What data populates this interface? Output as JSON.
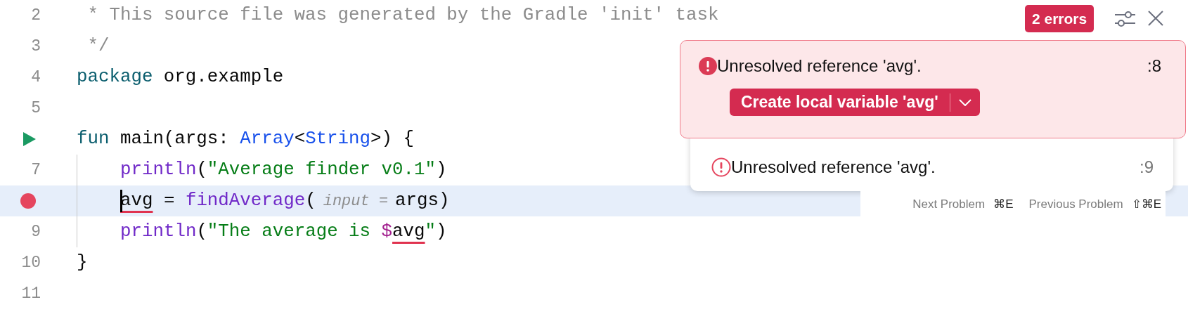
{
  "editor": {
    "lines": [
      {
        "number": "2",
        "tokens": [
          {
            "kind": "comment",
            "text": " * This source file was generated by the Gradle 'init' task"
          }
        ]
      },
      {
        "number": "3",
        "tokens": [
          {
            "kind": "comment",
            "text": " */"
          }
        ]
      },
      {
        "number": "4",
        "tokens": [
          {
            "kind": "keyword",
            "text": "package"
          },
          {
            "kind": "plain",
            "text": " org.example"
          }
        ]
      },
      {
        "number": "5"
      },
      {
        "gutter_icon": {
          "kind": "run"
        },
        "tokens": [
          {
            "kind": "keyword",
            "text": "fun"
          },
          {
            "kind": "plain",
            "text": " main(args: "
          },
          {
            "kind": "type",
            "text": "Array"
          },
          {
            "kind": "plain",
            "text": "<"
          },
          {
            "kind": "type",
            "text": "String"
          },
          {
            "kind": "plain",
            "text": ">) {"
          }
        ],
        "children": [
          {
            "number": "7",
            "tokens": [
              {
                "kind": "call",
                "text": "println"
              },
              {
                "kind": "plain",
                "text": "("
              },
              {
                "kind": "string",
                "text": "\"Average finder v0.1\""
              },
              {
                "kind": "plain",
                "text": ")"
              }
            ]
          },
          {
            "gutter_icon": {
              "kind": "breakpoint"
            },
            "current": true,
            "caret": true,
            "tokens": [
              {
                "kind": "plain",
                "text": "avg",
                "error": true
              },
              {
                "kind": "plain",
                "text": " = "
              },
              {
                "kind": "call",
                "text": "findAverage"
              },
              {
                "kind": "plain",
                "text": "("
              },
              {
                "kind": "hint",
                "text": "input ="
              },
              {
                "kind": "plain",
                "text": "args)"
              }
            ]
          },
          {
            "number": "9",
            "tokens": [
              {
                "kind": "call",
                "text": "println"
              },
              {
                "kind": "plain",
                "text": "("
              },
              {
                "kind": "string",
                "text": "\"The average is "
              },
              {
                "kind": "interp",
                "text": "$"
              },
              {
                "kind": "plain",
                "text": "avg",
                "error": true
              },
              {
                "kind": "string",
                "text": "\""
              },
              {
                "kind": "plain",
                "text": ")"
              }
            ]
          }
        ]
      },
      {
        "number": "10",
        "tokens": [
          {
            "kind": "plain",
            "text": "}"
          }
        ]
      },
      {
        "number": "11"
      }
    ]
  },
  "problems_popup": {
    "badge": "2 errors",
    "problems": [
      {
        "message": "Unresolved reference 'avg'.",
        "line": ":8",
        "selected": true,
        "fix": "Create local variable 'avg'"
      },
      {
        "message": "Unresolved reference 'avg'.",
        "line": ":9",
        "selected": false
      }
    ],
    "shortcuts": [
      {
        "label": "Next Problem",
        "keys": "⌘E"
      },
      {
        "label": "Previous Problem",
        "keys": "⇧⌘E"
      }
    ]
  }
}
